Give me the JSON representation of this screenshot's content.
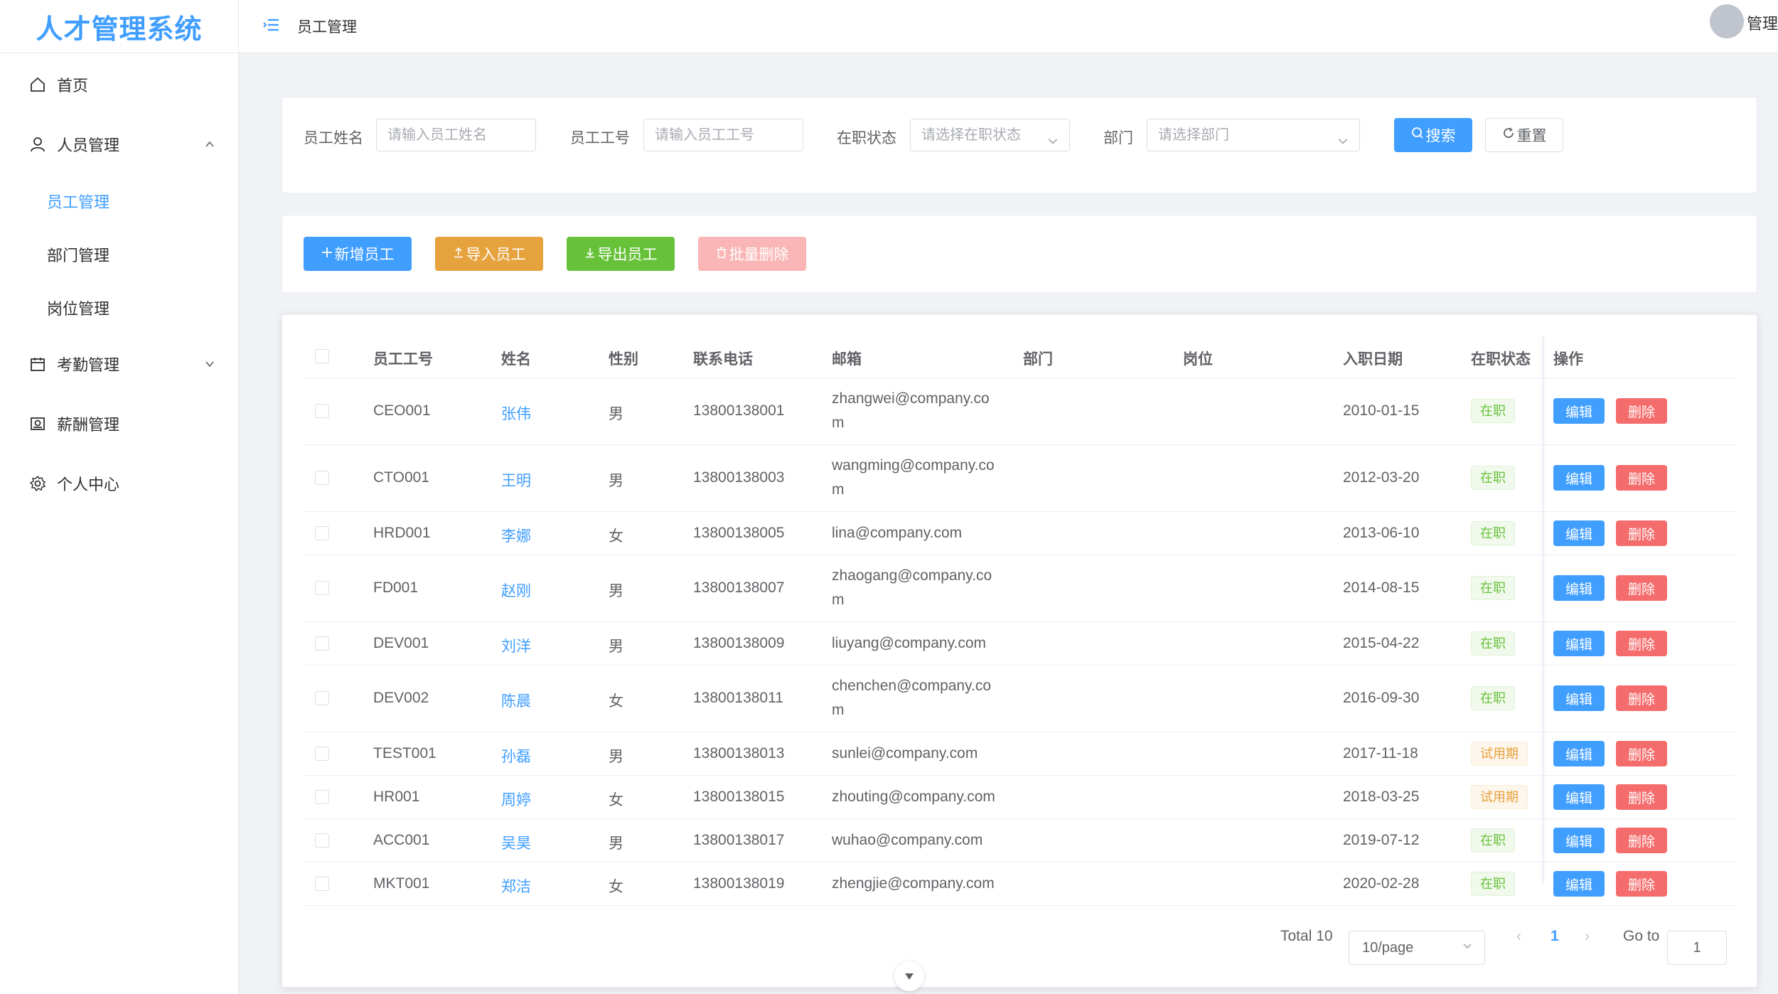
{
  "app": {
    "logo": "人才管理系统"
  },
  "sidebar": {
    "items": [
      {
        "label": "首页",
        "icon": "home-icon"
      },
      {
        "label": "人员管理",
        "icon": "user-icon",
        "expanded": true,
        "children": [
          {
            "label": "员工管理",
            "active": true
          },
          {
            "label": "部门管理"
          },
          {
            "label": "岗位管理"
          }
        ]
      },
      {
        "label": "考勤管理",
        "icon": "calendar-icon"
      },
      {
        "label": "薪酬管理",
        "icon": "money-icon"
      },
      {
        "label": "个人中心",
        "icon": "gear-icon"
      }
    ]
  },
  "header": {
    "breadcrumb": "员工管理",
    "user": "管理"
  },
  "search": {
    "name_label": "员工姓名",
    "name_placeholder": "请输入员工姓名",
    "id_label": "员工工号",
    "id_placeholder": "请输入员工工号",
    "status_label": "在职状态",
    "status_placeholder": "请选择在职状态",
    "dept_label": "部门",
    "dept_placeholder": "请选择部门",
    "search_btn": "搜索",
    "reset_btn": "重置"
  },
  "actions": {
    "add": "新增员工",
    "import": "导入员工",
    "export": "导出员工",
    "batch_delete": "批量删除"
  },
  "table": {
    "columns": [
      "员工工号",
      "姓名",
      "性别",
      "联系电话",
      "邮箱",
      "部门",
      "岗位",
      "入职日期",
      "在职状态",
      "操作"
    ],
    "edit_label": "编辑",
    "delete_label": "删除",
    "rows": [
      {
        "id": "CEO001",
        "name": "张伟",
        "gender": "男",
        "phone": "13800138001",
        "email": "zhangwei@company.co",
        "email2": "m",
        "date": "2010-01-15",
        "status": "在职"
      },
      {
        "id": "CTO001",
        "name": "王明",
        "gender": "男",
        "phone": "13800138003",
        "email": "wangming@company.co",
        "email2": "m",
        "date": "2012-03-20",
        "status": "在职"
      },
      {
        "id": "HRD001",
        "name": "李娜",
        "gender": "女",
        "phone": "13800138005",
        "email": "lina@company.com",
        "email2": "",
        "date": "2013-06-10",
        "status": "在职"
      },
      {
        "id": "FD001",
        "name": "赵刚",
        "gender": "男",
        "phone": "13800138007",
        "email": "zhaogang@company.co",
        "email2": "m",
        "date": "2014-08-15",
        "status": "在职"
      },
      {
        "id": "DEV001",
        "name": "刘洋",
        "gender": "男",
        "phone": "13800138009",
        "email": "liuyang@company.com",
        "email2": "",
        "date": "2015-04-22",
        "status": "在职"
      },
      {
        "id": "DEV002",
        "name": "陈晨",
        "gender": "女",
        "phone": "13800138011",
        "email": "chenchen@company.co",
        "email2": "m",
        "date": "2016-09-30",
        "status": "在职"
      },
      {
        "id": "TEST001",
        "name": "孙磊",
        "gender": "男",
        "phone": "13800138013",
        "email": "sunlei@company.com",
        "email2": "",
        "date": "2017-11-18",
        "status": "试用期"
      },
      {
        "id": "HR001",
        "name": "周婷",
        "gender": "女",
        "phone": "13800138015",
        "email": "zhouting@company.com",
        "email2": "",
        "date": "2018-03-25",
        "status": "试用期"
      },
      {
        "id": "ACC001",
        "name": "吴昊",
        "gender": "男",
        "phone": "13800138017",
        "email": "wuhao@company.com",
        "email2": "",
        "date": "2019-07-12",
        "status": "在职"
      },
      {
        "id": "MKT001",
        "name": "郑洁",
        "gender": "女",
        "phone": "13800138019",
        "email": "zhengjie@company.com",
        "email2": "",
        "date": "2020-02-28",
        "status": "在职"
      }
    ]
  },
  "pagination": {
    "total": "Total 10",
    "page_size": "10/page",
    "current": "1",
    "goto_label": "Go to",
    "goto_value": "1"
  },
  "colors": {
    "primary": "#409eff",
    "warning": "#e6a23c",
    "success": "#67c23a",
    "danger": "#f56c6c"
  }
}
